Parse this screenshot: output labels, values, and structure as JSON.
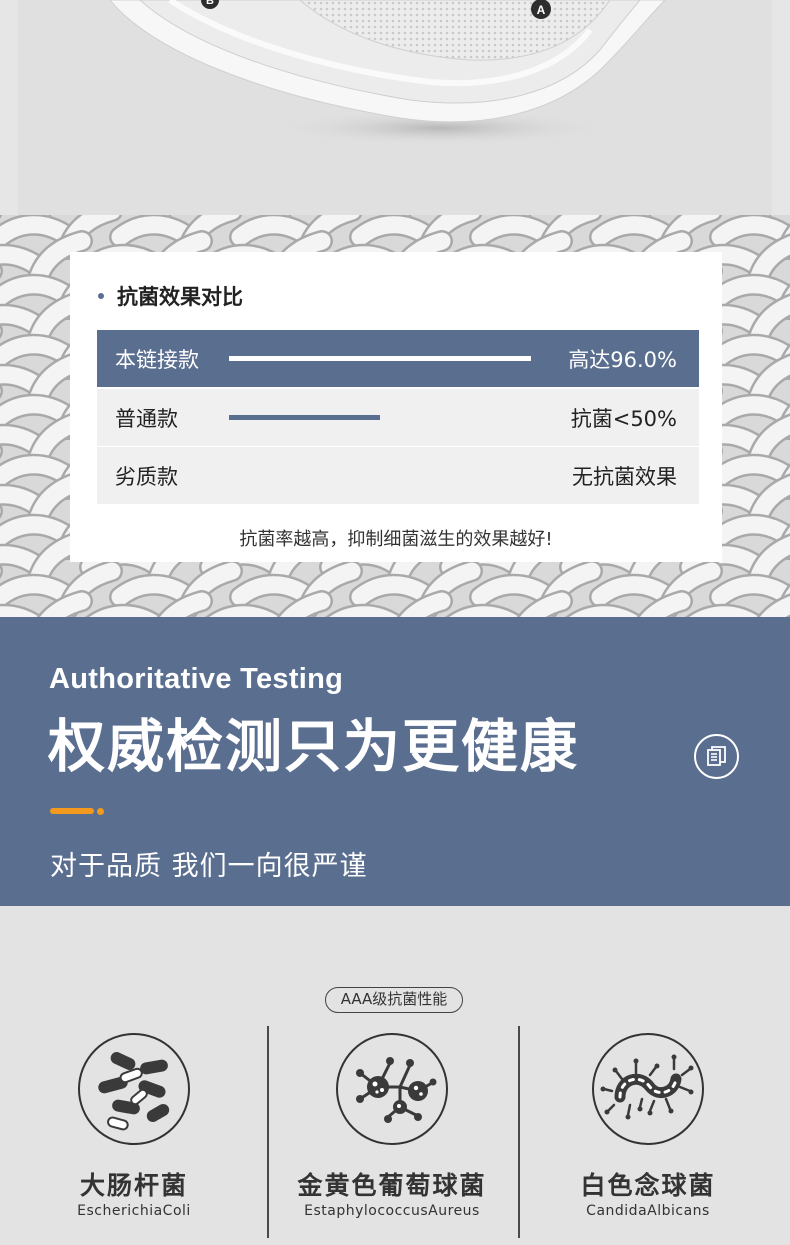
{
  "colors": {
    "brand_blue": "#5a6e90",
    "accent_orange": "#f39a1e",
    "background_gray": "#e3e3e3",
    "text_dark": "#222222"
  },
  "product_diagram": {
    "marker_a": "A",
    "marker_b": "B"
  },
  "comparison": {
    "title": "抗菌效果对比",
    "rows": [
      {
        "name": "本链接款",
        "value": "高达96.0%",
        "bar_fraction": 1.0
      },
      {
        "name": "普通款",
        "value": "抗菌<50%",
        "bar_fraction": 0.5
      },
      {
        "name": "劣质款",
        "value": "无抗菌效果",
        "bar_fraction": 0
      }
    ],
    "note": "抗菌率越高，抑制细菌滋生的效果越好!"
  },
  "banner": {
    "title_en": "Authoritative Testing",
    "title_cn": "权威检测只为更健康",
    "subtitle": "对于品质  我们一向很严谨",
    "icon": "document-icon"
  },
  "bacteria": {
    "badge": "AAA级抗菌性能",
    "items": [
      {
        "name_cn": "大肠杆菌",
        "name_en": "EscherichiaColi",
        "icon": "rod-bacteria-icon"
      },
      {
        "name_cn": "金黄色葡萄球菌",
        "name_en": "EstaphylococcusAureus",
        "icon": "staphylococcus-icon"
      },
      {
        "name_cn": "白色念球菌",
        "name_en": "CandidaAlbicans",
        "icon": "candida-icon"
      }
    ]
  }
}
